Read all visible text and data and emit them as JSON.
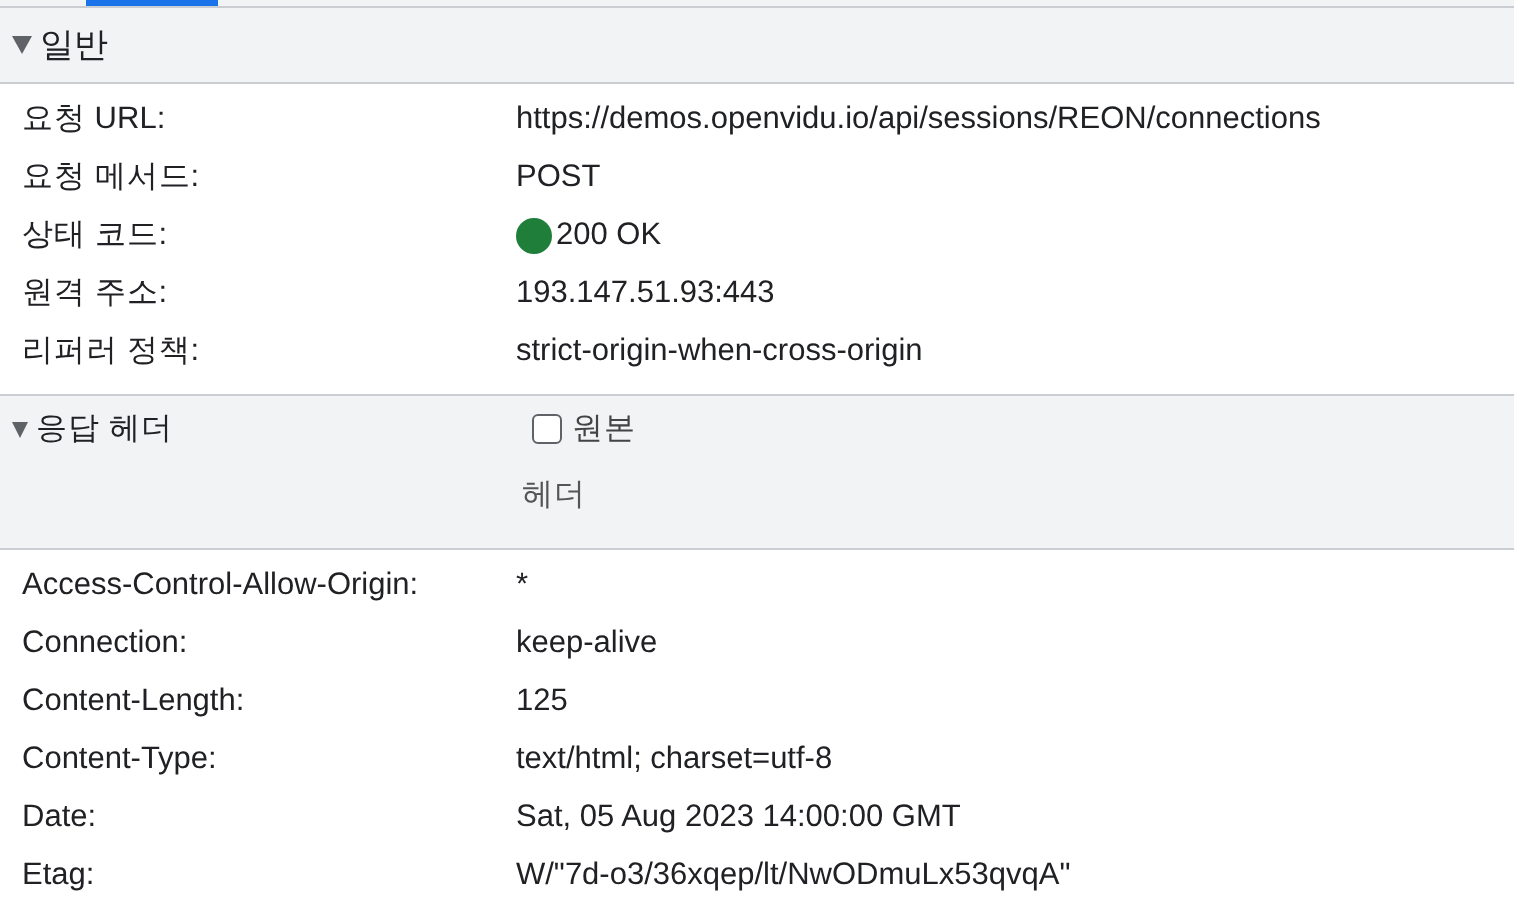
{
  "general": {
    "title": "일반",
    "expanded": true,
    "rows": [
      {
        "name": "요청 URL:",
        "value": "https://demos.openvidu.io/api/sessions/REON/connections"
      },
      {
        "name": "요청 메서드:",
        "value": "POST"
      },
      {
        "name": "상태 코드:",
        "value": "200 OK",
        "color": "#1e7e3a"
      },
      {
        "name": "원격 주소:",
        "value": "193.147.51.93:443"
      },
      {
        "name": "리퍼러 정책:",
        "value": "strict-origin-when-cross-origin"
      }
    ]
  },
  "response_headers": {
    "title": "응답 헤더",
    "expanded": true,
    "raw_checkbox": {
      "label": "원본",
      "checked": false
    },
    "column_label": "헤더",
    "rows": [
      {
        "name": "Access-Control-Allow-Origin:",
        "value": "*"
      },
      {
        "name": "Connection:",
        "value": "keep-alive"
      },
      {
        "name": "Content-Length:",
        "value": "125"
      },
      {
        "name": "Content-Type:",
        "value": "text/html; charset=utf-8"
      },
      {
        "name": "Date:",
        "value": "Sat, 05 Aug 2023 14:00:00 GMT"
      },
      {
        "name": "Etag:",
        "value": "W/\"7d-o3/36xqep/lt/NwODmuLx53qvqA\""
      }
    ]
  }
}
